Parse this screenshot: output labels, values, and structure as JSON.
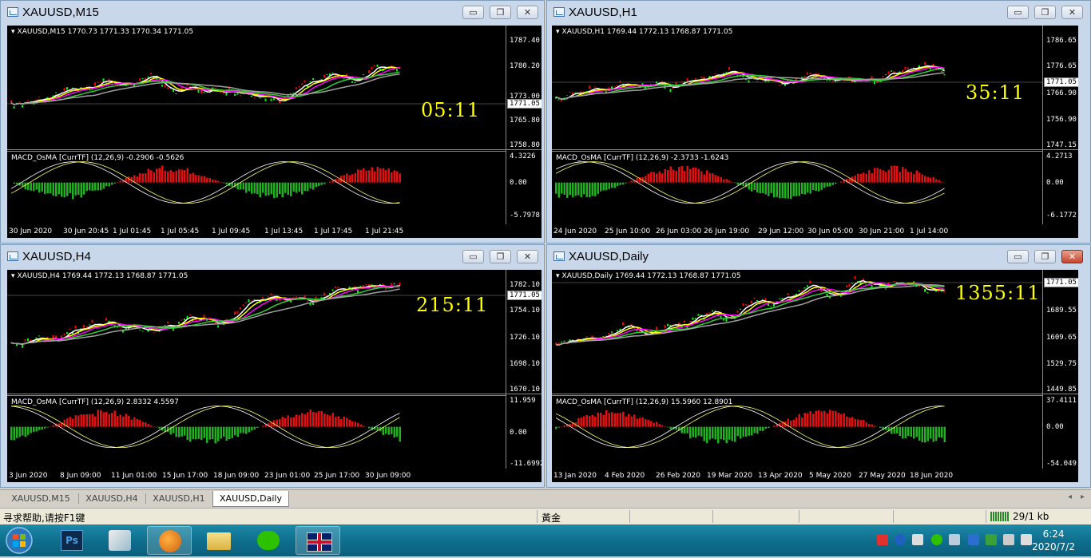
{
  "windows": [
    {
      "id": "m15",
      "title": "XAUUSD,M15",
      "info": "XAUUSD,M15  1770.73 1771.33 1770.34 1771.05",
      "timer": "05:11",
      "price_tag": "1771.05",
      "price_axis": [
        "1787.40",
        "1780.20",
        "1773.00",
        "1765.80",
        "1758.80"
      ],
      "macd_info": "MACD_OsMA [CurrTF] (12,26,9) -0.2906 -0.5626",
      "macd_axis": [
        "4.3226",
        "0.00",
        "-5.7978"
      ],
      "x_labels": [
        "30 Jun 2020",
        "30 Jun 20:45",
        "1 Jul 01:45",
        "1 Jul 05:45",
        "1 Jul 09:45",
        "1 Jul 13:45",
        "1 Jul 17:45",
        "1 Jul 21:45"
      ]
    },
    {
      "id": "h1",
      "title": "XAUUSD,H1",
      "info": "XAUUSD,H1  1769.44 1772.13 1768.87 1771.05",
      "timer": "35:11",
      "price_tag": "1771.05",
      "price_axis": [
        "1786.65",
        "1776.65",
        "1766.90",
        "1756.90",
        "1747.15"
      ],
      "macd_info": "MACD_OsMA [CurrTF] (12,26,9) -2.3733 -1.6243",
      "macd_axis": [
        "4.2713",
        "0.00",
        "-6.1772"
      ],
      "x_labels": [
        "24 Jun 2020",
        "25 Jun 10:00",
        "26 Jun 03:00",
        "26 Jun 19:00",
        "29 Jun 12:00",
        "30 Jun 05:00",
        "30 Jun 21:00",
        "1 Jul 14:00"
      ]
    },
    {
      "id": "h4",
      "title": "XAUUSD,H4",
      "info": "XAUUSD,H4  1769.44 1772.13 1768.87 1771.05",
      "timer": "215:11",
      "price_tag": "1771.05",
      "price_axis": [
        "1782.10",
        "1754.10",
        "1726.10",
        "1698.10",
        "1670.10"
      ],
      "macd_info": "MACD_OsMA [CurrTF] (12,26,9) 2.8332 4.5597",
      "macd_axis": [
        "11.959",
        "0.00",
        "-11.6992"
      ],
      "x_labels": [
        "3 Jun 2020",
        "8 Jun 09:00",
        "11 Jun 01:00",
        "15 Jun 17:00",
        "18 Jun 09:00",
        "23 Jun 01:00",
        "25 Jun 17:00",
        "30 Jun 09:00"
      ]
    },
    {
      "id": "daily",
      "title": "XAUUSD,Daily",
      "info": "XAUUSD,Daily  1769.44 1772.13 1768.87 1771.05",
      "timer": "1355:11",
      "price_tag": "1771.05",
      "price_axis": [
        "1689.55",
        "1609.65",
        "1529.75",
        "1449.85"
      ],
      "macd_info": "MACD_OsMA [CurrTF] (12,26,9) 15.5960 12.8901",
      "macd_axis": [
        "37.4111",
        "0.00",
        "-54.049"
      ],
      "x_labels": [
        "13 Jan 2020",
        "4 Feb 2020",
        "26 Feb 2020",
        "19 Mar 2020",
        "13 Apr 2020",
        "5 May 2020",
        "27 May 2020",
        "18 Jun 2020"
      ]
    }
  ],
  "tabs": [
    "XAUUSD,M15",
    "XAUUSD,H4",
    "XAUUSD,H1",
    "XAUUSD,Daily"
  ],
  "active_tab": "XAUUSD,Daily",
  "status": {
    "help": "寻求帮助,请按F1键",
    "profile": "黃金",
    "traffic": "29/1 kb"
  },
  "clock": {
    "time": "6:24",
    "date": "2020/7/2"
  },
  "colors": {
    "chart_bg": "#000000",
    "bull_candle": "#00ff00",
    "bear_candle": "#ff0000",
    "ma_white": "#ffffff",
    "ma_yellow": "#ffff00",
    "ma_magenta": "#ff00ff",
    "ma_green": "#32cd32",
    "ma_gray": "#a0a0a0",
    "timer": "#ffff00"
  }
}
